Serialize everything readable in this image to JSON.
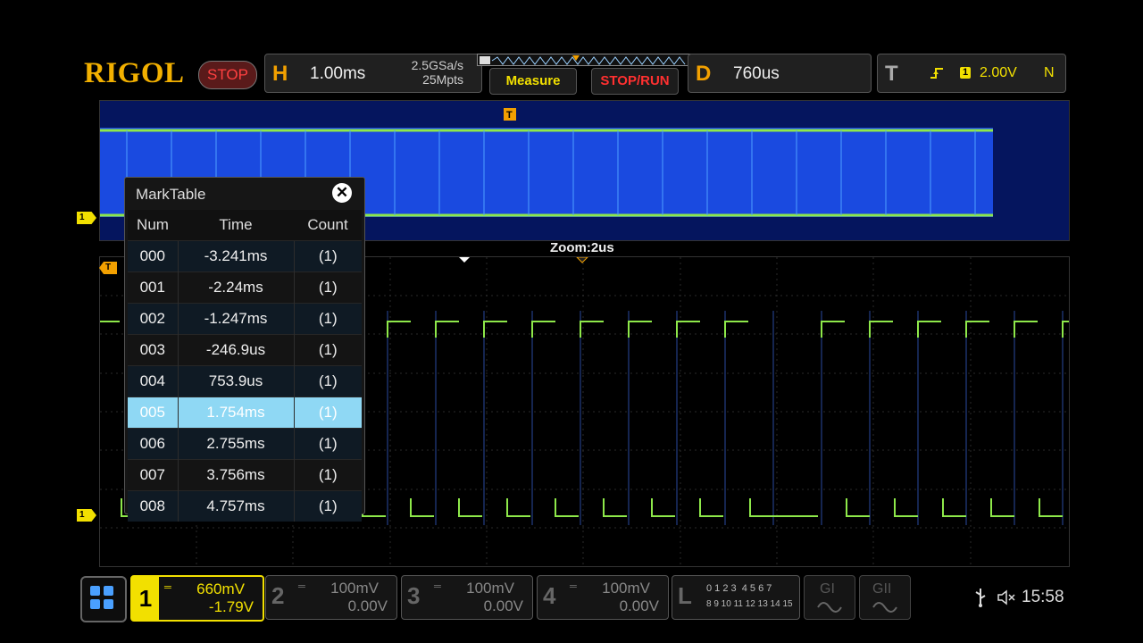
{
  "brand": "RIGOL",
  "run_state": "STOP",
  "horizontal": {
    "letter": "H",
    "timebase": "1.00ms",
    "sample_rate": "2.5GSa/s",
    "memory_depth": "25Mpts"
  },
  "buttons": {
    "measure": "Measure",
    "stop_run": "STOP/RUN"
  },
  "delay": {
    "letter": "D",
    "value": "760us"
  },
  "trigger": {
    "letter": "T",
    "source": "1",
    "level": "2.00V",
    "mode": "N"
  },
  "overview": {
    "zoom_label": "Zoom:2us",
    "channel_marker": "1"
  },
  "main": {
    "channel_marker": "1"
  },
  "marktable": {
    "title": "MarkTable",
    "headers": [
      "Num",
      "Time",
      "Count"
    ],
    "selected_index": 5,
    "rows": [
      {
        "num": "000",
        "time": "-3.241ms",
        "count": "(1)"
      },
      {
        "num": "001",
        "time": "-2.24ms",
        "count": "(1)"
      },
      {
        "num": "002",
        "time": "-1.247ms",
        "count": "(1)"
      },
      {
        "num": "003",
        "time": "-246.9us",
        "count": "(1)"
      },
      {
        "num": "004",
        "time": "753.9us",
        "count": "(1)"
      },
      {
        "num": "005",
        "time": "1.754ms",
        "count": "(1)"
      },
      {
        "num": "006",
        "time": "2.755ms",
        "count": "(1)"
      },
      {
        "num": "007",
        "time": "3.756ms",
        "count": "(1)"
      },
      {
        "num": "008",
        "time": "4.757ms",
        "count": "(1)"
      }
    ]
  },
  "channels": [
    {
      "num": "1",
      "scale": "660mV",
      "offset": "-1.79V"
    },
    {
      "num": "2",
      "scale": "100mV",
      "offset": "0.00V"
    },
    {
      "num": "3",
      "scale": "100mV",
      "offset": "0.00V"
    },
    {
      "num": "4",
      "scale": "100mV",
      "offset": "0.00V"
    }
  ],
  "logic": {
    "letter": "L",
    "row1": "0 1 2 3  4 5 6 7",
    "row2": "8 9 10 11 12 13 14 15"
  },
  "generators": [
    "GI",
    "GII"
  ],
  "status": {
    "time": "15:58"
  },
  "colors": {
    "ch1": "#f2e000",
    "accent": "#f2a000",
    "stop": "#ff4040",
    "overview_bg": "#05155e",
    "overview_wave": "#1a4ae0",
    "trace": "#8ee84a"
  }
}
